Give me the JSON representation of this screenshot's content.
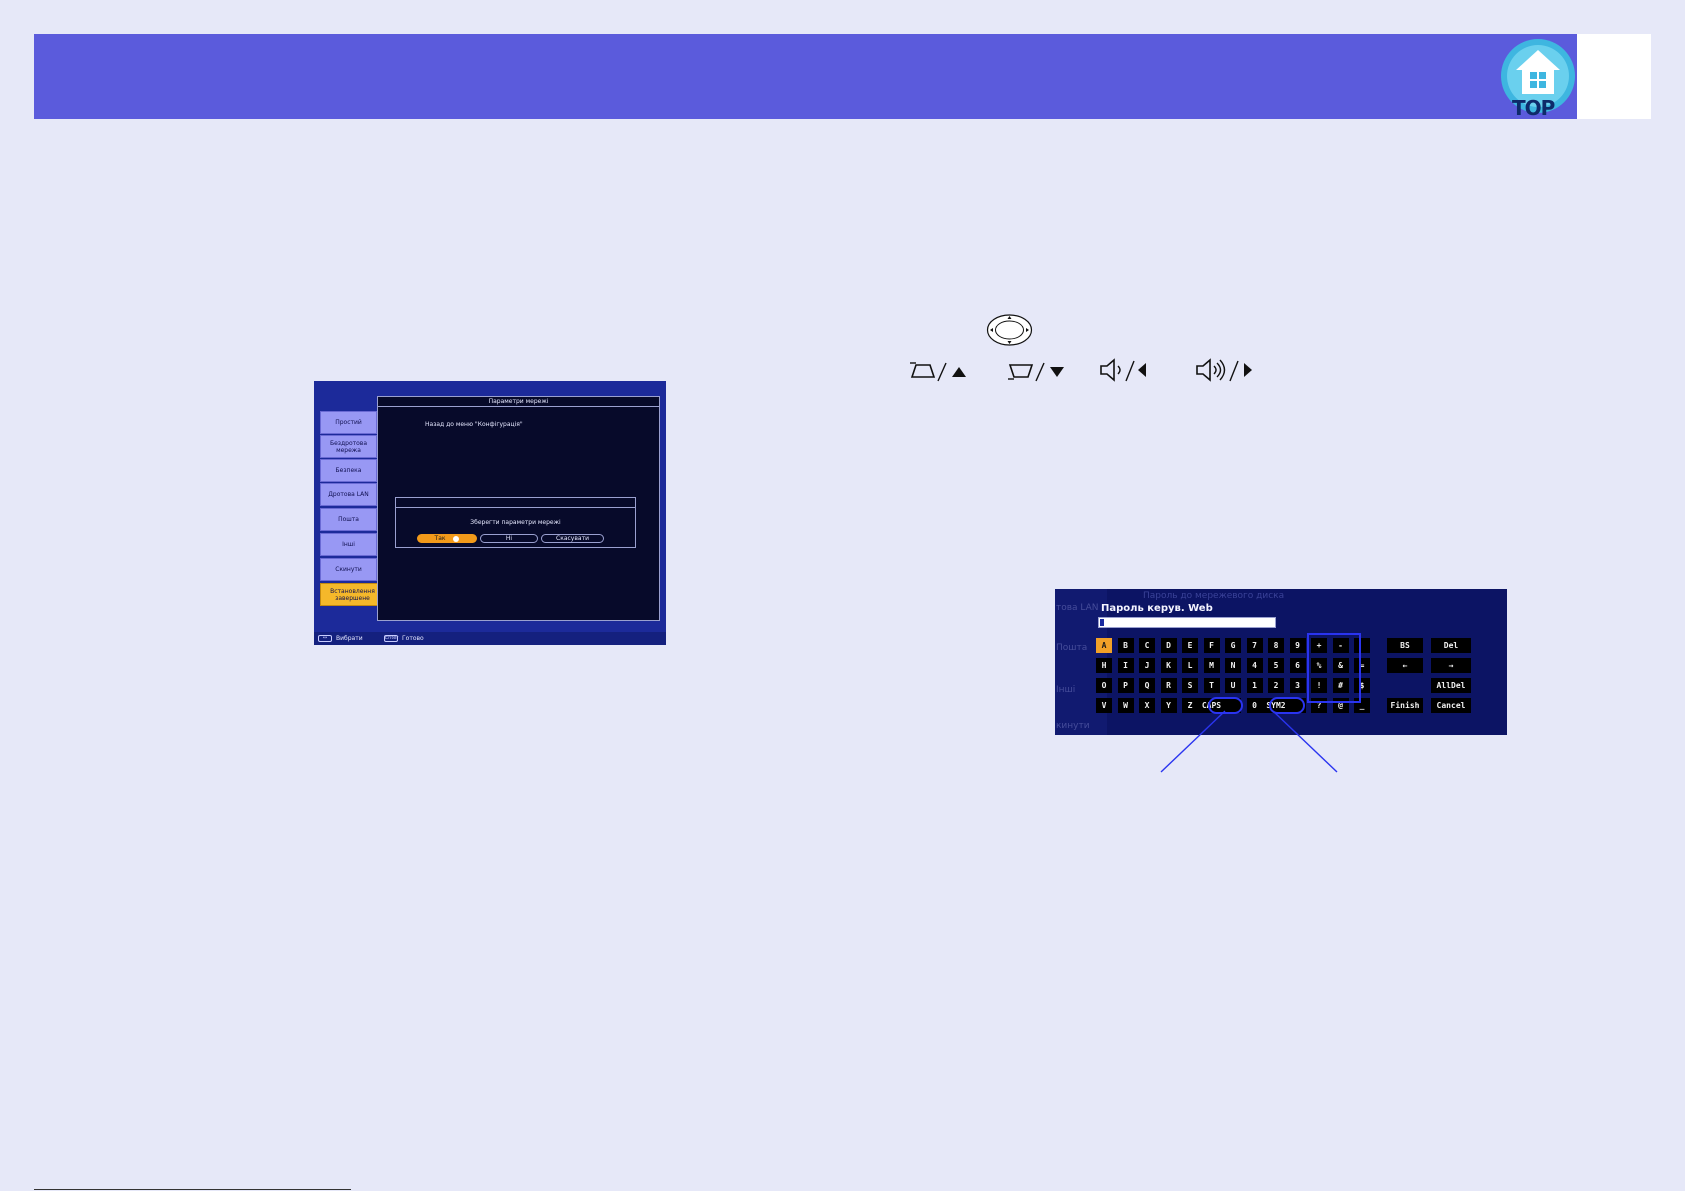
{
  "header": {
    "top_label": "TOP",
    "logo_icon": "home-icon",
    "band_color": "#5b5bdc"
  },
  "network_screen": {
    "panel_title": "Параметри мережі",
    "back_link": "Назад до меню \"Конфігурація\"",
    "sidebar": [
      {
        "label": "Простий"
      },
      {
        "label": "Бездротова мережа"
      },
      {
        "label": "Безпека"
      },
      {
        "label": "Дротова LAN"
      },
      {
        "label": "Пошта"
      },
      {
        "label": "Інші"
      },
      {
        "label": "Скинути"
      },
      {
        "label": "Встановлення завершене",
        "active": true
      }
    ],
    "dialog": {
      "message": "Зберегти параметри мережі",
      "buttons": [
        {
          "label": "Так",
          "selected": true
        },
        {
          "label": "Ні"
        },
        {
          "label": "Скасувати"
        }
      ]
    },
    "footer": {
      "select_icon": "↔",
      "select_label": "Вибрати",
      "enter_icon": "Enter",
      "done_label": "Готово"
    }
  },
  "remote_icons": {
    "dpad": "dpad-icon",
    "keystone_up": "keystone-up-icon",
    "keystone_down": "keystone-down-icon",
    "volume_down": "volume-down-icon",
    "volume_up": "volume-up-icon"
  },
  "keyboard_screen": {
    "ghost_title": "Пароль до мережевого диска",
    "title": "Пароль керув. Web",
    "ghost_sidebar": [
      "това LAN",
      "Пошта",
      "Інші",
      "кинути"
    ],
    "rows": [
      [
        "A",
        "B",
        "C",
        "D",
        "E",
        "F",
        "G",
        "7",
        "8",
        "9",
        "+",
        "-",
        ""
      ],
      [
        "H",
        "I",
        "J",
        "K",
        "L",
        "M",
        "N",
        "4",
        "5",
        "6",
        "%",
        "&",
        "="
      ],
      [
        "O",
        "P",
        "Q",
        "R",
        "S",
        "T",
        "U",
        "1",
        "2",
        "3",
        "!",
        "#",
        "$"
      ],
      [
        "V",
        "W",
        "X",
        "Y",
        "Z",
        "CAPS",
        "",
        "0",
        "SYM2",
        "",
        "?",
        "@",
        "_"
      ]
    ],
    "side_keys": {
      "bs": "BS",
      "del": "Del",
      "left": "←",
      "right": "→",
      "alldel": "AllDel",
      "finish": "Finish",
      "cancel": "Cancel"
    }
  }
}
